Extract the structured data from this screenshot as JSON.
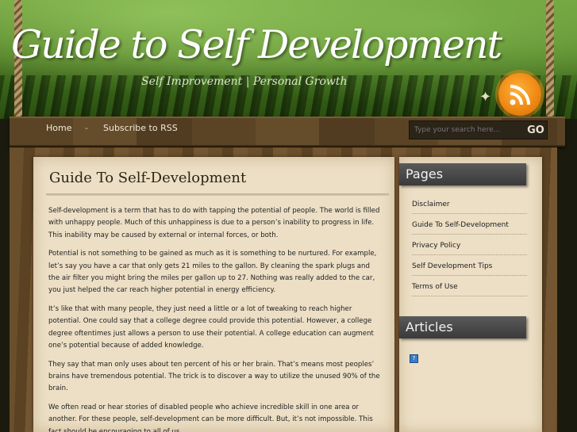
{
  "site": {
    "title": "Guide to Self Development",
    "tagline": "Self Improvement | Personal Growth"
  },
  "nav": {
    "home": "Home",
    "separator": "-",
    "subscribe": "Subscribe to RSS"
  },
  "search": {
    "placeholder": "Type your search here...",
    "go_label": "GO"
  },
  "post": {
    "title": "Guide To Self-Development",
    "paragraphs": [
      "Self-development is a term that has to do with tapping the potential of people. The world is filled with unhappy people. Much of this unhappiness is due to a person’s inability to progress in life. This inability may be caused by external or internal forces, or both.",
      "Potential is not something to be gained as much as it is something to be nurtured. For example, let’s say you have a car that only gets 21 miles to the gallon. By cleaning the spark plugs and the air filter you might bring the miles per gallon up to 27. Nothing was really added to the car, you just helped the car reach higher potential in energy efficiency.",
      "It’s like that with many people, they just need a little or a lot of tweaking to reach higher potential. One could say that a college degree could provide this potential. However, a college degree oftentimes just allows a person to use their potential. A college education can augment one’s potential because of added knowledge.",
      "They say that man only uses about ten percent of his or her brain. That’s means most peoples’ brains have tremendous potential. The trick is to discover a way to utilize the unused 90% of the brain.",
      "We often read or hear stories of disabled people who achieve incredible skill in one area or another. For these people, self-development can be more difficult. But, it’s not impossible. This fact should be encouraging to all of us."
    ]
  },
  "sidebar": {
    "pages_title": "Pages",
    "pages": [
      "Disclaimer",
      "Guide To Self-Development",
      "Privacy Policy",
      "Self Development Tips",
      "Terms of Use"
    ],
    "articles_title": "Articles"
  },
  "icons": {
    "rss": "rss-icon",
    "article": "article-icon"
  },
  "colors": {
    "rss": "#f08a14",
    "paper": "#ecdfc5",
    "widget_title": "#444444"
  }
}
